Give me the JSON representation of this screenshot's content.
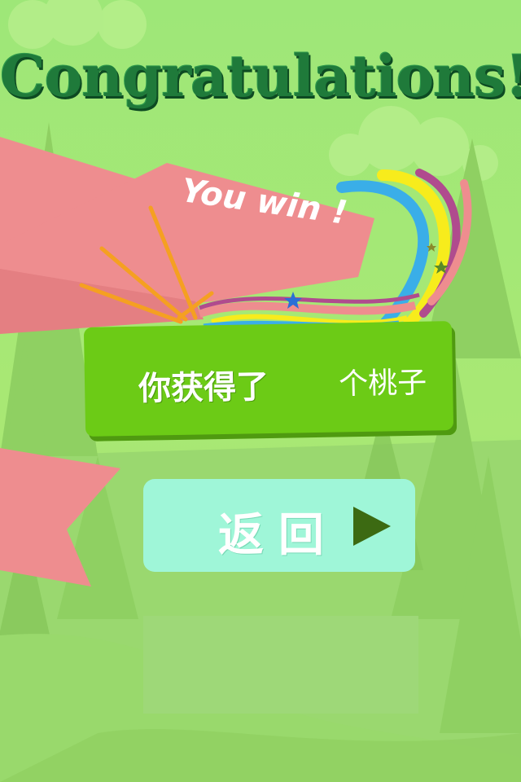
{
  "screen": {
    "title": "Congratulations!",
    "banner_text": "You win !",
    "score": {
      "prefix": "你获得了",
      "value": "",
      "suffix": "个桃子"
    },
    "back_button": {
      "label": "返回"
    },
    "colors": {
      "background": "#a6e676",
      "title": "#1f7a3a",
      "ribbon": "#ee8d8f",
      "score_panel": "#6ccb16",
      "back_button": "#9ff6d8",
      "play_icon": "#3c6a12"
    },
    "icons": [
      "play-icon",
      "star-icon"
    ]
  }
}
